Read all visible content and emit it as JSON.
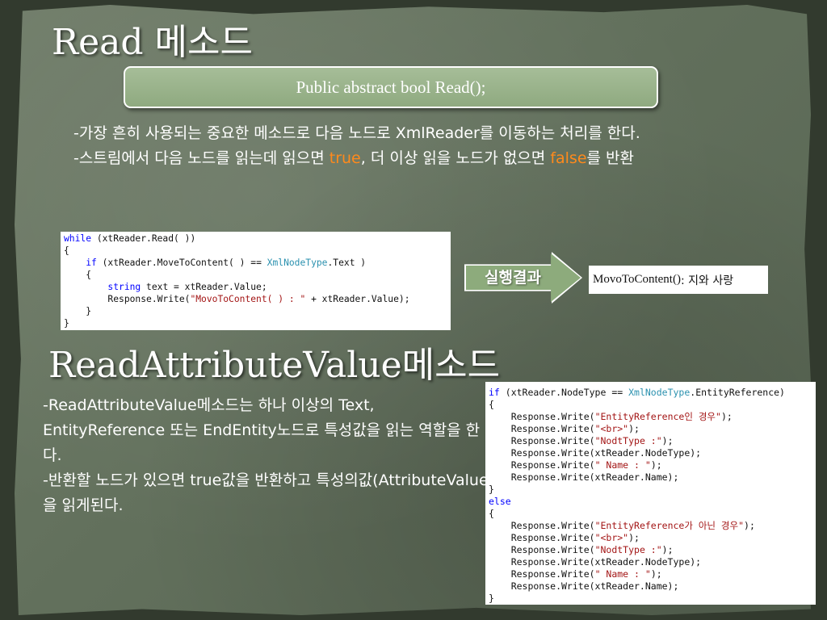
{
  "slide": {
    "title1": "Read 메소드",
    "signature": "Public abstract bool Read();",
    "desc1": {
      "line1": "-가장 흔히 사용되는 중요한 메소드로 다음 노드로 XmlReader를 이동하는 처리를 한다.",
      "line2_pre": "-스트림에서 다음 노드를 읽는데 읽으면 ",
      "line2_true": "true",
      "line2_mid": ", 더 이상 읽을 노드가 없으면 ",
      "line2_false": "false",
      "line2_post": "를 반환"
    },
    "code1": [
      [
        {
          "t": "while",
          "c": "kw"
        },
        {
          "t": " (xtReader.Read( ))"
        }
      ],
      [
        {
          "t": "{"
        }
      ],
      [
        {
          "t": "    "
        },
        {
          "t": "if",
          "c": "kw"
        },
        {
          "t": " (xtReader.MoveToContent( ) == "
        },
        {
          "t": "XmlNodeType",
          "c": "ty"
        },
        {
          "t": ".Text )"
        }
      ],
      [
        {
          "t": "    {"
        }
      ],
      [
        {
          "t": "        "
        },
        {
          "t": "string",
          "c": "kw"
        },
        {
          "t": " text = xtReader.Value;"
        }
      ],
      [
        {
          "t": "        Response.Write("
        },
        {
          "t": "\"MovoToContent( ) : \"",
          "c": "st"
        },
        {
          "t": " + xtReader.Value);"
        }
      ],
      [
        {
          "t": "    }"
        }
      ],
      [
        {
          "t": "}"
        }
      ]
    ],
    "arrow_label": "실행결과",
    "result": {
      "method": "MovoToContent()",
      "text": " : 지와 사랑"
    },
    "title2": "ReadAttributeValue메소드",
    "desc2": {
      "line1": "-ReadAttributeValue메소드는 하나 이상의 Text, EntityReference 또는 EndEntity노드로 특성값을 읽는 역할을 한다.",
      "line2": "-반환할 노드가 있으면 true값을 반환하고 특성의값(AttributeValue)을 읽게된다."
    },
    "code2": [
      [
        {
          "t": "if",
          "c": "kw"
        },
        {
          "t": " (xtReader.NodeType == "
        },
        {
          "t": "XmlNodeType",
          "c": "ty"
        },
        {
          "t": ".EntityReference)"
        }
      ],
      [
        {
          "t": "{"
        }
      ],
      [
        {
          "t": "    Response.Write("
        },
        {
          "t": "\"EntityReference인 경우\"",
          "c": "st"
        },
        {
          "t": ");"
        }
      ],
      [
        {
          "t": "    Response.Write("
        },
        {
          "t": "\"<br>\"",
          "c": "st"
        },
        {
          "t": ");"
        }
      ],
      [
        {
          "t": "    Response.Write("
        },
        {
          "t": "\"NodtType :\"",
          "c": "st"
        },
        {
          "t": ");"
        }
      ],
      [
        {
          "t": "    Response.Write(xtReader.NodeType);"
        }
      ],
      [
        {
          "t": "    Response.Write("
        },
        {
          "t": "\" Name : \"",
          "c": "st"
        },
        {
          "t": ");"
        }
      ],
      [
        {
          "t": "    Response.Write(xtReader.Name);"
        }
      ],
      [
        {
          "t": "}"
        }
      ],
      [
        {
          "t": "else",
          "c": "kw"
        }
      ],
      [
        {
          "t": "{"
        }
      ],
      [
        {
          "t": "    Response.Write("
        },
        {
          "t": "\"EntityReference가 아닌 경우\"",
          "c": "st"
        },
        {
          "t": ");"
        }
      ],
      [
        {
          "t": "    Response.Write("
        },
        {
          "t": "\"<br>\"",
          "c": "st"
        },
        {
          "t": ");"
        }
      ],
      [
        {
          "t": "    Response.Write("
        },
        {
          "t": "\"NodtType :\"",
          "c": "st"
        },
        {
          "t": ");"
        }
      ],
      [
        {
          "t": "    Response.Write(xtReader.NodeType);"
        }
      ],
      [
        {
          "t": "    Response.Write("
        },
        {
          "t": "\" Name : \"",
          "c": "st"
        },
        {
          "t": ");"
        }
      ],
      [
        {
          "t": "    Response.Write(xtReader.Name);"
        }
      ],
      [
        {
          "t": "}"
        }
      ]
    ],
    "colors": {
      "highlight": "#ff8a1c",
      "keyword": "#0000ff",
      "type": "#2b91af",
      "string": "#a31515"
    }
  }
}
